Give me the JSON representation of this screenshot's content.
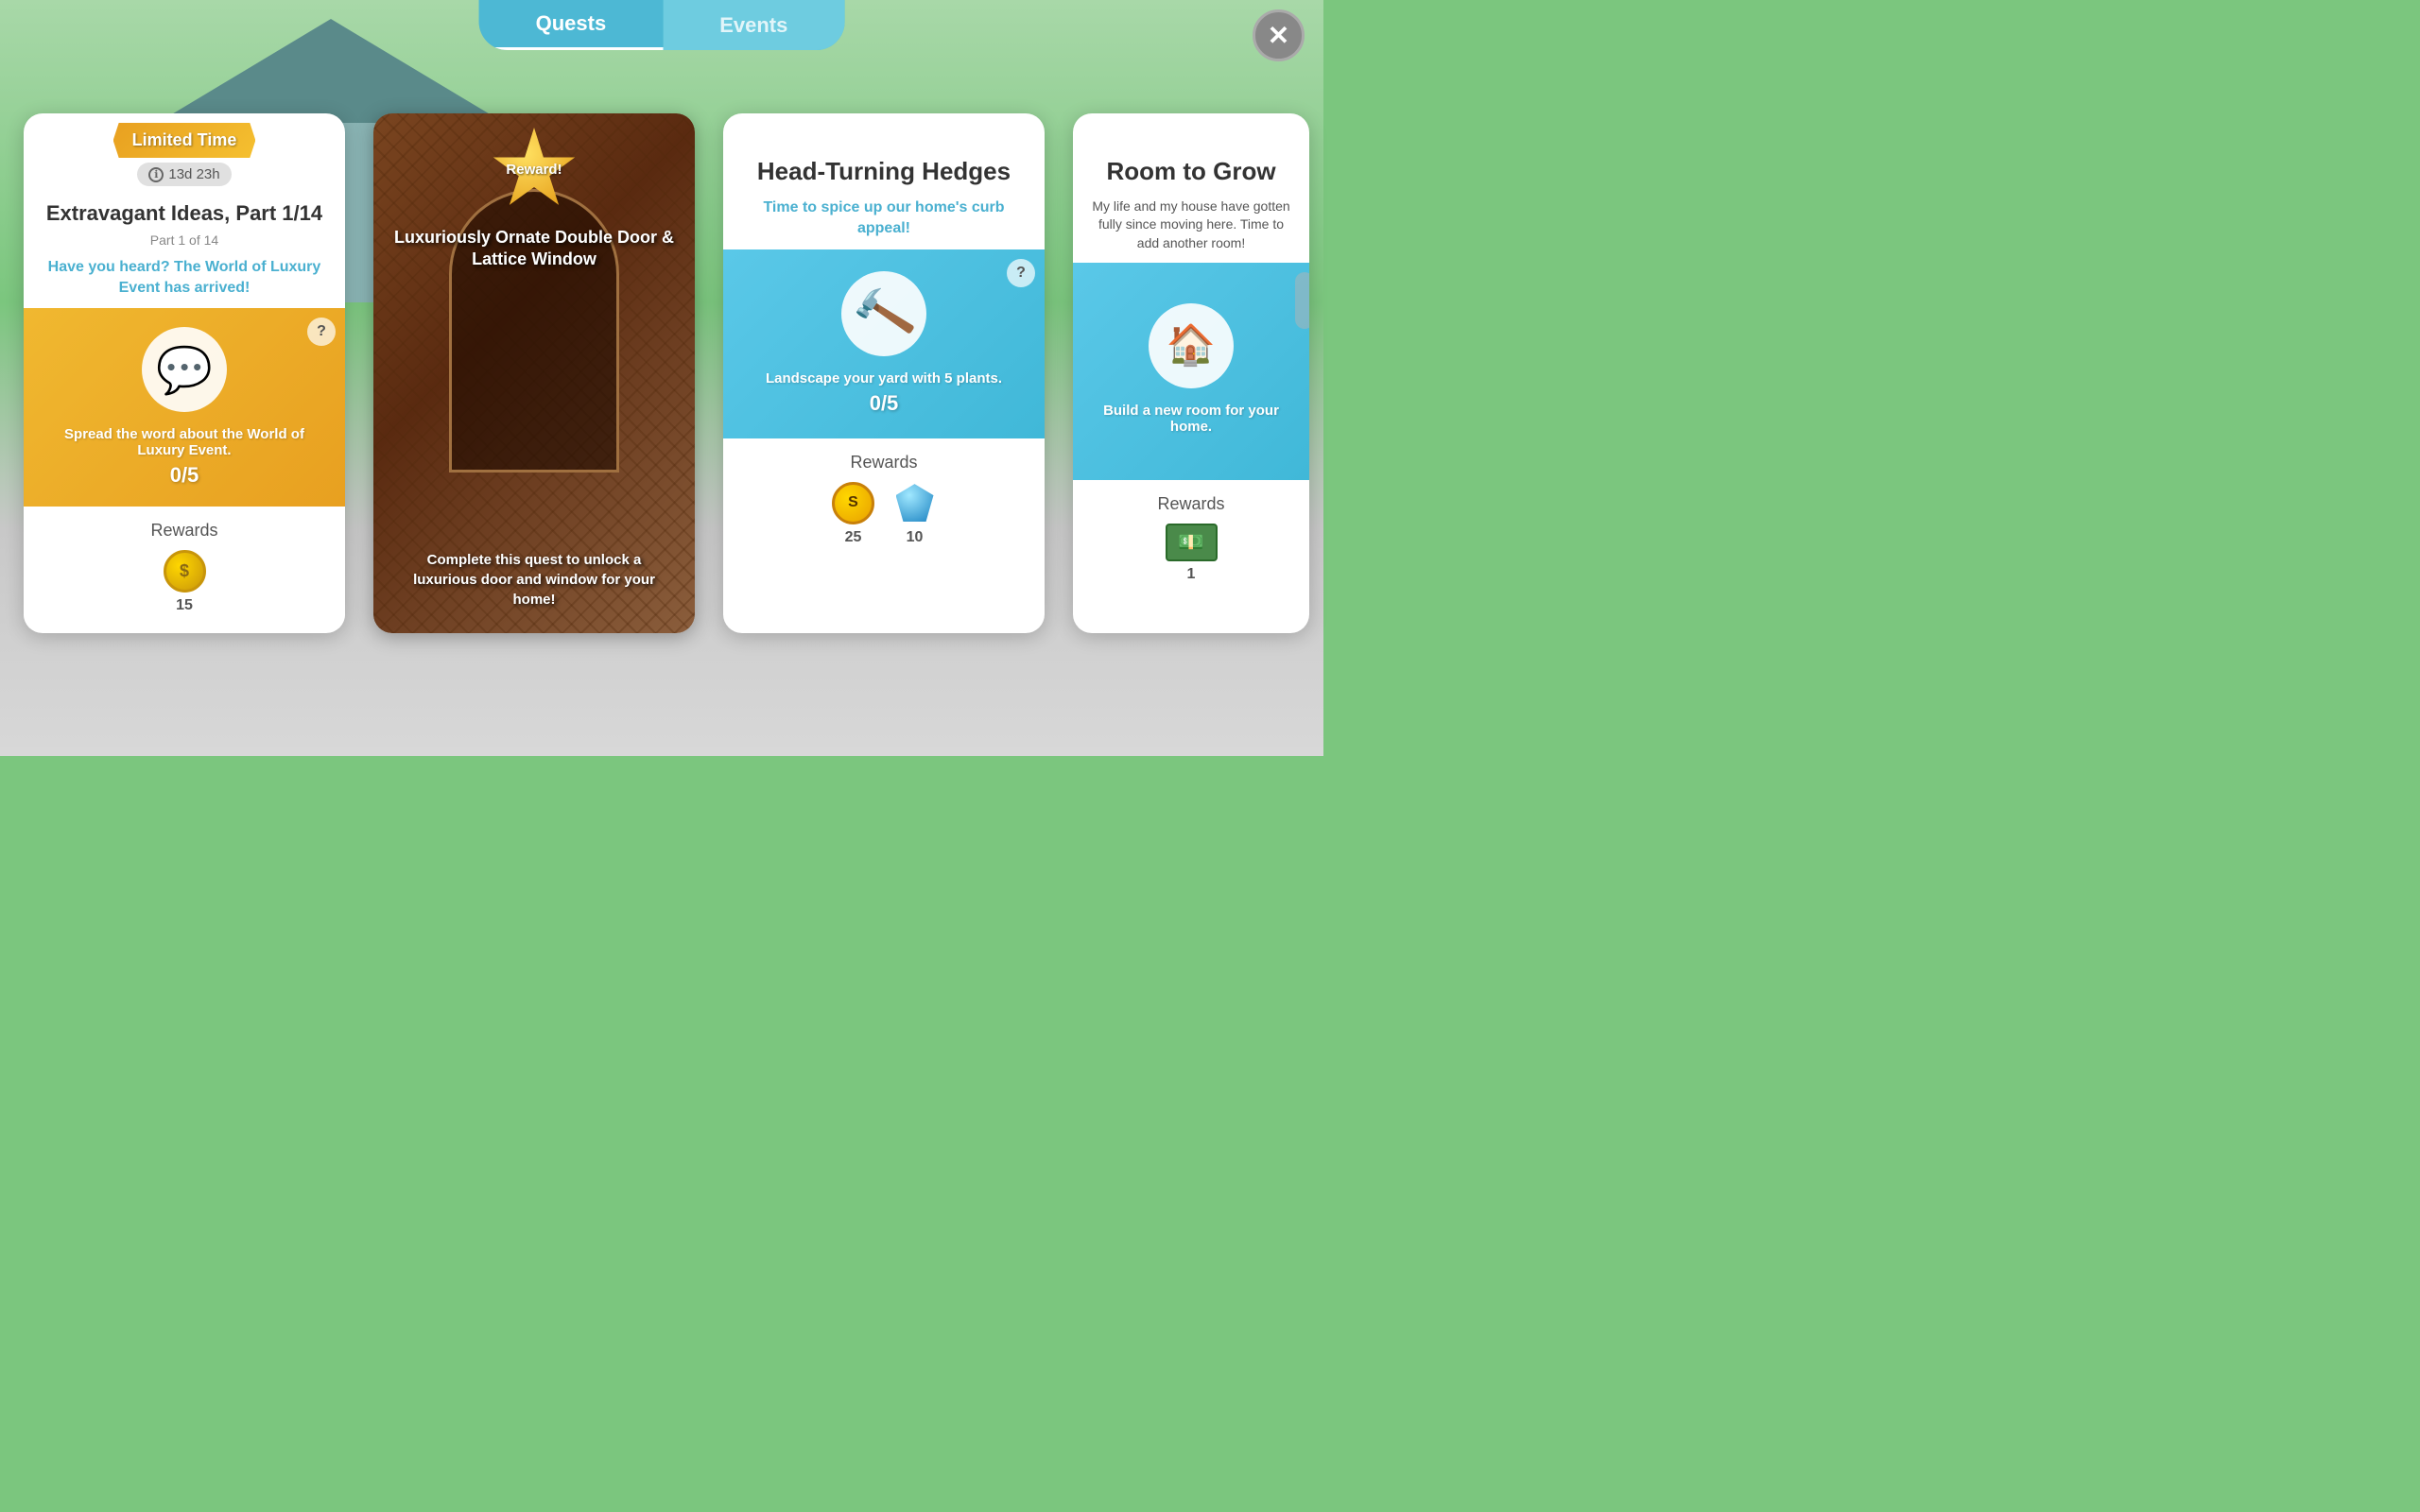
{
  "background": {
    "color": "#7bc67e"
  },
  "nav": {
    "tabs": [
      {
        "id": "quests",
        "label": "Quests",
        "active": true
      },
      {
        "id": "events",
        "label": "Events",
        "active": false
      }
    ],
    "close_button": "✕"
  },
  "cards": [
    {
      "id": "card-limited-time",
      "type": "limited_time",
      "banner_label": "Limited Time",
      "timer": "🕐 13d 23h",
      "timer_text": "13d 23h",
      "title": "Extravagant Ideas, Part 1/14",
      "subtitle": "Part 1 of 14",
      "description": "Have you heard? The World of Luxury Event has arrived!",
      "action_text": "Spread the word about the World of Luxury Event.",
      "progress": "0/5",
      "rewards_label": "Rewards",
      "rewards": [
        {
          "type": "coin",
          "count": "15"
        }
      ]
    },
    {
      "id": "card-reward",
      "type": "reward_overlay",
      "badge_label": "Reward!",
      "item_name": "Luxuriously Ornate Double Door & Lattice Window",
      "description": "Complete this quest to unlock a luxurious door and window for your home!"
    },
    {
      "id": "card-hedges",
      "type": "quest",
      "title": "Head-Turning Hedges",
      "description": "Time to spice up our home's curb appeal!",
      "action_text": "Landscape your yard with 5 plants.",
      "progress": "0/5",
      "rewards_label": "Rewards",
      "rewards": [
        {
          "type": "simoleon",
          "count": "25"
        },
        {
          "type": "gem",
          "count": "10"
        }
      ]
    },
    {
      "id": "card-room",
      "type": "quest",
      "title": "Room to Grow",
      "description": "My life and my house have gotten fully since moving here. Time to add another room!",
      "action_text": "Build a new room for your home.",
      "progress": "",
      "rewards_label": "Rewards",
      "rewards": [
        {
          "type": "money",
          "count": "1"
        }
      ]
    }
  ],
  "icons": {
    "chat": "💬",
    "tools": "🔨",
    "house": "🏠",
    "coin": "🪙",
    "simoleon": "💰",
    "gem": "💎",
    "money": "💵",
    "question": "?",
    "close": "✕",
    "info": "ℹ"
  }
}
